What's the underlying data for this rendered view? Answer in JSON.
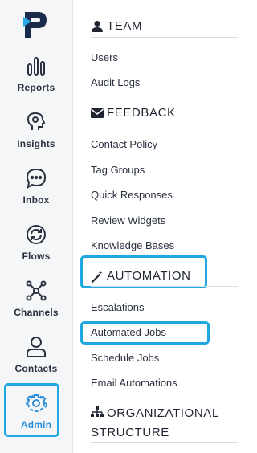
{
  "nav": [
    {
      "label": "Reports",
      "icon": "bar-chart-icon"
    },
    {
      "label": "Insights",
      "icon": "head-bulb-icon"
    },
    {
      "label": "Inbox",
      "icon": "chat-bubble-icon"
    },
    {
      "label": "Flows",
      "icon": "sync-icon"
    },
    {
      "label": "Channels",
      "icon": "network-icon"
    },
    {
      "label": "Contacts",
      "icon": "user-icon"
    },
    {
      "label": "Admin",
      "icon": "gear-icon",
      "active": true
    }
  ],
  "sections": {
    "team": {
      "title": "TEAM",
      "items": [
        "Users",
        "Audit Logs"
      ]
    },
    "feedback": {
      "title": "FEEDBACK",
      "items": [
        "Contact Policy",
        "Tag Groups",
        "Quick Responses",
        "Review Widgets",
        "Knowledge Bases"
      ]
    },
    "automation": {
      "title": "AUTOMATION",
      "items": [
        "Escalations",
        "Automated Jobs",
        "Schedule Jobs",
        "Email Automations"
      ]
    },
    "org": {
      "title_line1": "ORGANIZATIONAL",
      "title_line2": "STRUCTURE"
    }
  },
  "colors": {
    "accent": "#1ea7e1",
    "logo": "#1a2a4a",
    "active_text": "#2f8fd8"
  }
}
